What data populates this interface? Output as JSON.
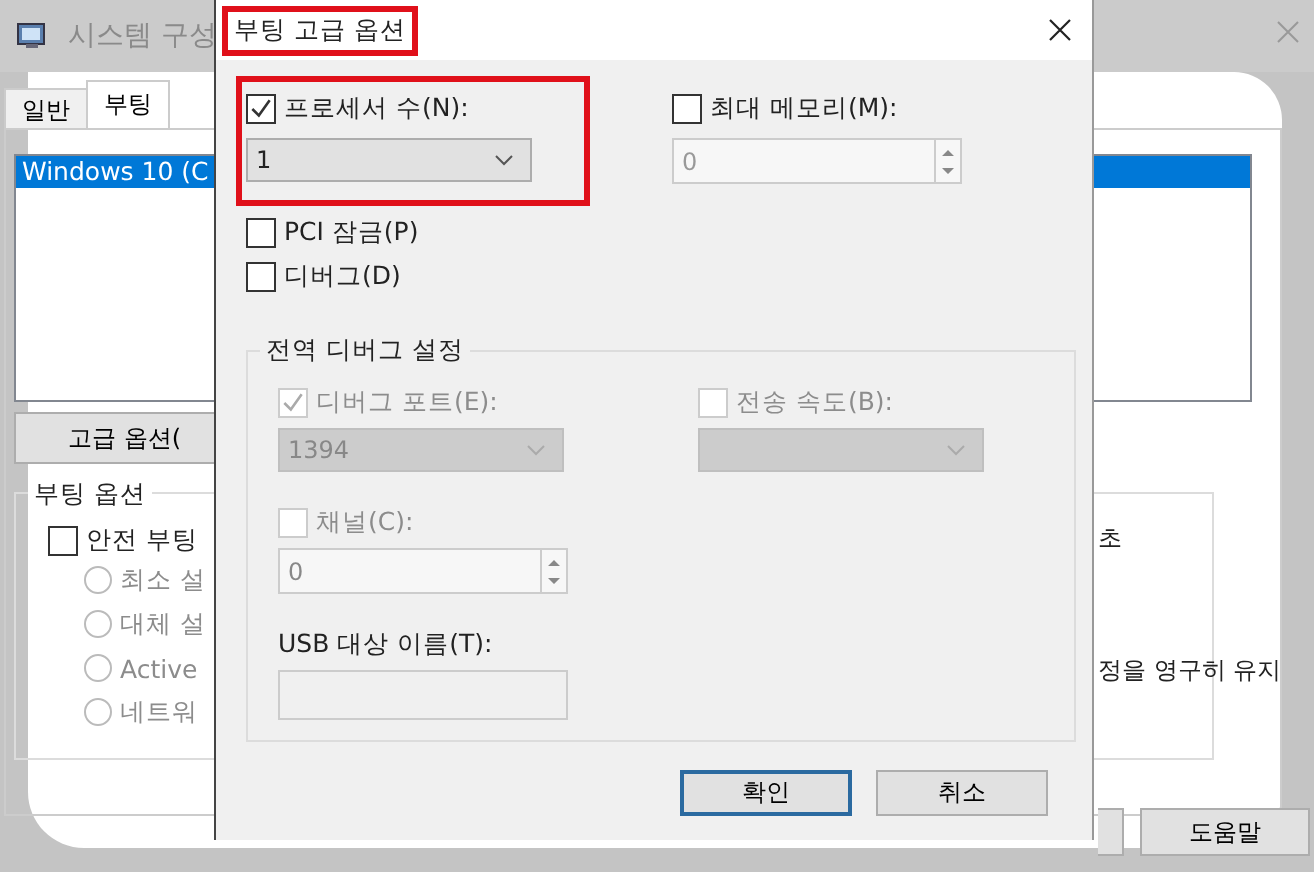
{
  "background_window": {
    "title": "시스템 구성",
    "tabs": [
      {
        "label": "일반",
        "selected": false
      },
      {
        "label": "부팅",
        "selected": true
      }
    ],
    "boot_list": [
      {
        "label": "Windows 10 (C",
        "selected": true
      }
    ],
    "advanced_button": "고급 옵션(",
    "boot_options": {
      "title": "부팅 옵션",
      "safe_boot": {
        "label": "안전 부팅",
        "checked": false
      },
      "radios": [
        {
          "label": "최소 설",
          "selected": false,
          "disabled": true
        },
        {
          "label": "대체 설",
          "selected": false,
          "disabled": true
        },
        {
          "label": "Active",
          "selected": false,
          "disabled": true
        },
        {
          "label": "네트워",
          "selected": false,
          "disabled": true
        }
      ]
    },
    "timeout_fragment": "초",
    "persist_fragment": "정을 영구히 유지",
    "buttons": [
      "도움말"
    ]
  },
  "dialog": {
    "title": "부팅 고급 옵션",
    "title_highlighted": true,
    "processors": {
      "label": "프로세서 수(N):",
      "checked": true,
      "value": "1",
      "highlighted": true
    },
    "max_memory": {
      "label": "최대 메모리(M):",
      "checked": false,
      "value": "0"
    },
    "pci_lock": {
      "label": "PCI 잠금(P)",
      "checked": false
    },
    "debug": {
      "label": "디버그(D)",
      "checked": false
    },
    "debug_settings": {
      "title": "전역 디버그 설정",
      "debug_port": {
        "label": "디버그 포트(E):",
        "checked": true,
        "disabled": true,
        "value": "1394"
      },
      "baud_rate": {
        "label": "전송 속도(B):",
        "checked": false,
        "disabled": true
      },
      "channel": {
        "label": "채널(C):",
        "checked": false,
        "disabled": true,
        "value": "0"
      },
      "usb_target": {
        "label": "USB 대상 이름(T):"
      }
    },
    "buttons": [
      {
        "label": "확인",
        "default": true
      },
      {
        "label": "취소",
        "default": false
      }
    ]
  }
}
